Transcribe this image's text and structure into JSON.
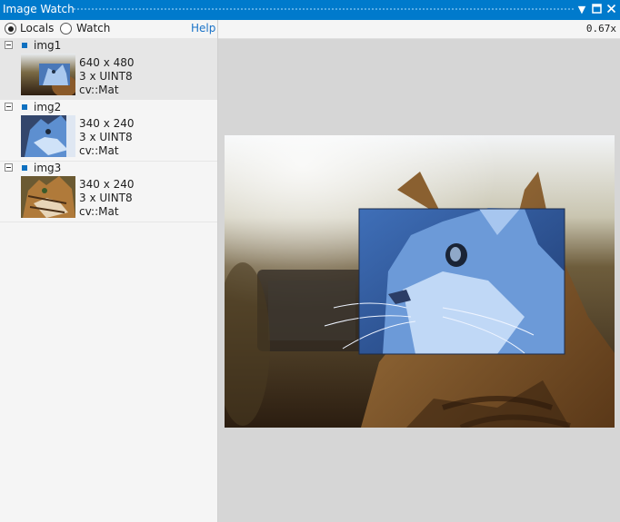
{
  "window": {
    "title": "Image Watch"
  },
  "toolbar": {
    "locals_label": "Locals",
    "watch_label": "Watch",
    "help_label": "Help",
    "zoom": "0.67x"
  },
  "images": [
    {
      "name": "img1",
      "size": "640 x 480",
      "format": "3 x UINT8",
      "type": "cv::Mat"
    },
    {
      "name": "img2",
      "size": "340 x 240",
      "format": "3 x UINT8",
      "type": "cv::Mat"
    },
    {
      "name": "img3",
      "size": "340 x 240",
      "format": "3 x UINT8",
      "type": "cv::Mat"
    }
  ]
}
